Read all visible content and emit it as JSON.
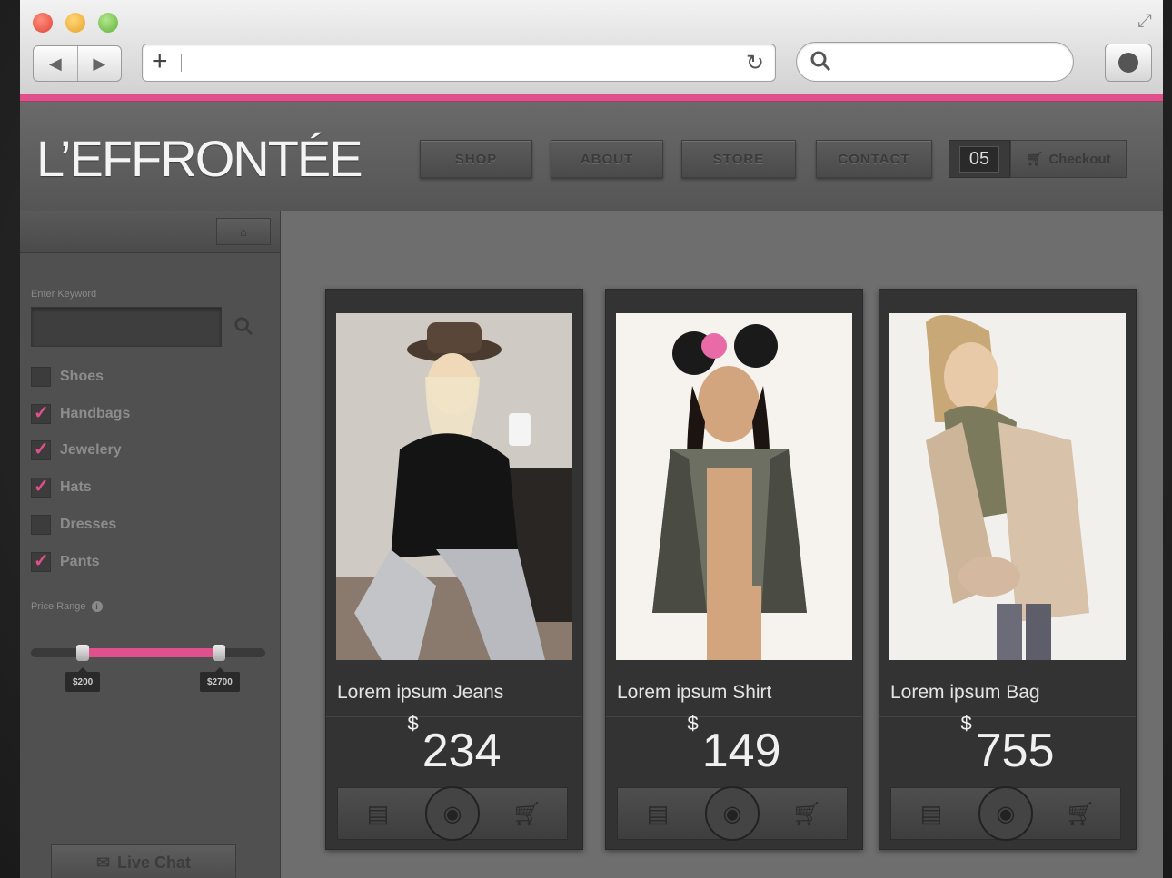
{
  "browser": {
    "url_value": "",
    "search_value": ""
  },
  "site": {
    "logo": "L’EFFRONTÉE",
    "nav": [
      "SHOP",
      "ABOUT",
      "STORE",
      "CONTACT"
    ],
    "cart_count": "05",
    "checkout_label": "Checkout",
    "accent_color": "#e0508c"
  },
  "sidebar": {
    "keyword_label": "Enter Keyword",
    "keyword_value": "",
    "categories": [
      {
        "label": "Shoes",
        "checked": false
      },
      {
        "label": "Handbags",
        "checked": true
      },
      {
        "label": "Jewelery",
        "checked": true
      },
      {
        "label": "Hats",
        "checked": true
      },
      {
        "label": "Dresses",
        "checked": false
      },
      {
        "label": "Pants",
        "checked": true
      }
    ],
    "price_label": "Price Range",
    "price_min": "$200",
    "price_max": "$2700",
    "live_chat": "Live Chat"
  },
  "products": [
    {
      "name": "Lorem ipsum Jeans",
      "currency": "$",
      "price": "234"
    },
    {
      "name": "Lorem ipsum Shirt",
      "currency": "$",
      "price": "149"
    },
    {
      "name": "Lorem ipsum Bag",
      "currency": "$",
      "price": "755"
    }
  ]
}
